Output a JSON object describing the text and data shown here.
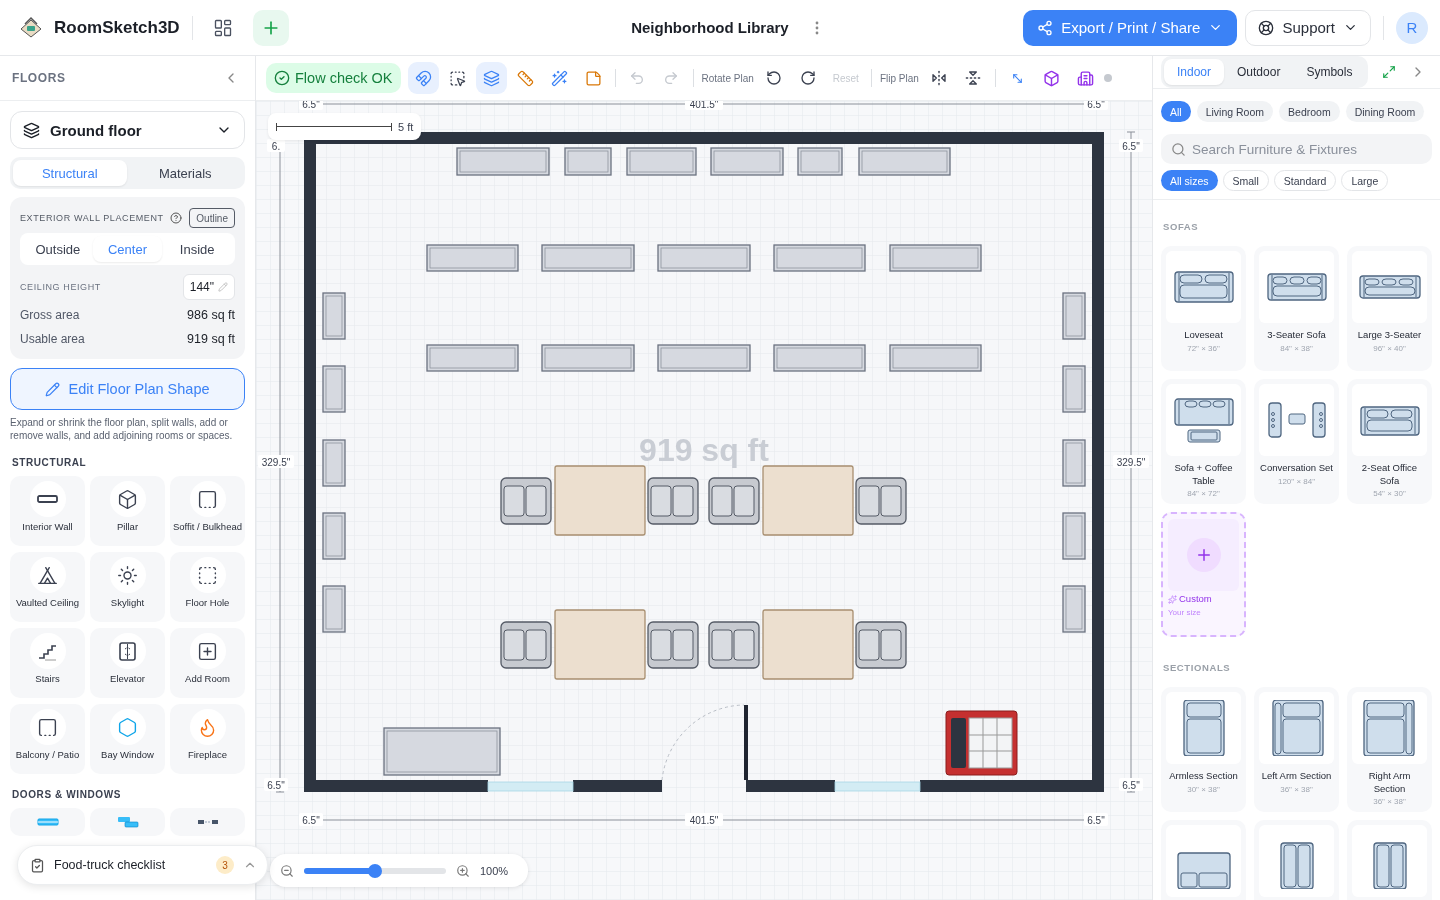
{
  "header": {
    "app_name": "RoomSketch3D",
    "project_title": "Neighborhood Library",
    "export_label": "Export / Print / Share",
    "support_label": "Support",
    "avatar": "R"
  },
  "sidebar": {
    "title": "FLOORS",
    "floor": "Ground floor",
    "tabs": [
      {
        "label": "Structural",
        "selected": true
      },
      {
        "label": "Materials",
        "selected": false
      }
    ],
    "wall_placement": {
      "label": "EXTERIOR WALL PLACEMENT",
      "mode": "Outline",
      "options": [
        {
          "label": "Outside",
          "selected": false
        },
        {
          "label": "Center",
          "selected": true
        },
        {
          "label": "Inside",
          "selected": false
        }
      ]
    },
    "ceiling": {
      "label": "CEILING HEIGHT",
      "value": "144\""
    },
    "areas": [
      {
        "label": "Gross area",
        "value": "986 sq ft"
      },
      {
        "label": "Usable area",
        "value": "919 sq ft"
      }
    ],
    "edit_button": "Edit Floor Plan Shape",
    "help_text": "Expand or shrink the floor plan, split walls, add or remove walls, and add adjoining rooms or spaces.",
    "sections": [
      {
        "title": "STRUCTURAL",
        "items": [
          {
            "kind": "interior-wall",
            "label": "Interior Wall"
          },
          {
            "kind": "pillar",
            "label": "Pillar"
          },
          {
            "kind": "soffit",
            "label": "Soffit / Bulkhead"
          },
          {
            "kind": "vaulted",
            "label": "Vaulted Ceiling"
          },
          {
            "kind": "skylight",
            "label": "Skylight"
          },
          {
            "kind": "floor-hole",
            "label": "Floor Hole"
          },
          {
            "kind": "stairs",
            "label": "Stairs"
          },
          {
            "kind": "elevator",
            "label": "Elevator"
          },
          {
            "kind": "add-room",
            "label": "Add Room"
          },
          {
            "kind": "balcony",
            "label": "Balcony / Patio"
          },
          {
            "kind": "bay-window",
            "label": "Bay Window"
          },
          {
            "kind": "fireplace",
            "label": "Fireplace"
          }
        ]
      },
      {
        "title": "DOORS & WINDOWS",
        "items": [
          {
            "kind": "window"
          },
          {
            "kind": "sliding-window"
          },
          {
            "kind": "opening"
          }
        ]
      }
    ],
    "checklist": {
      "label": "Food-truck checklist",
      "count": "3"
    }
  },
  "toolbar": {
    "status": "Flow check OK",
    "tools": [
      {
        "kind": "magnet",
        "active": true
      },
      {
        "kind": "select",
        "active": false
      },
      {
        "kind": "layers",
        "active": true
      },
      {
        "kind": "ruler",
        "active": false
      },
      {
        "kind": "wand",
        "active": false
      },
      {
        "kind": "note",
        "active": false
      }
    ],
    "history": [
      {
        "kind": "undo",
        "disabled": true
      },
      {
        "kind": "redo",
        "disabled": true
      }
    ],
    "rotate_label": "Rotate Plan",
    "reset": {
      "label": "Reset",
      "disabled": true
    },
    "flip_label": "Flip Plan"
  },
  "plan": {
    "area_label": "919 sq ft",
    "scale_label": "5 ft",
    "top": [
      "6.5\"",
      "401.5\"",
      "6.5\""
    ],
    "bottom": [
      "6.5\"",
      "401.5\"",
      "6.5\""
    ],
    "left": "329.5\"",
    "right": "329.5\"",
    "corners": [
      "6.",
      "6.5\"",
      "6.5\"",
      "6.5\""
    ],
    "zoom": {
      "level": 0.5,
      "reading": "100%"
    }
  },
  "library": {
    "tabs": [
      {
        "label": "Indoor",
        "selected": true
      },
      {
        "label": "Outdoor",
        "selected": false
      },
      {
        "label": "Symbols",
        "selected": false
      }
    ],
    "categories": [
      {
        "label": "All",
        "selected": true
      },
      {
        "label": "Living Room",
        "selected": false
      },
      {
        "label": "Bedroom",
        "selected": false
      },
      {
        "label": "Dining Room",
        "selected": false
      }
    ],
    "search": {
      "placeholder": "Search Furniture & Fixtures"
    },
    "sizes": [
      {
        "label": "All sizes",
        "selected": true
      },
      {
        "label": "Small",
        "selected": false
      },
      {
        "label": "Standard",
        "selected": false
      },
      {
        "label": "Large",
        "selected": false
      }
    ],
    "sections": [
      {
        "title": "SOFAS",
        "items": [
          {
            "kind": "loveseat",
            "name": "Loveseat",
            "size": "72\" × 36\""
          },
          {
            "kind": "three-seater",
            "name": "3-Seater Sofa",
            "size": "84\" × 38\""
          },
          {
            "kind": "large-three",
            "name": "Large 3-Seater",
            "size": "96\" × 40\""
          },
          {
            "kind": "sofa-table",
            "name": "Sofa + Coffee Table",
            "size": "84\" × 72\""
          },
          {
            "kind": "conversation",
            "name": "Conversation Set",
            "size": "120\" × 84\""
          },
          {
            "kind": "office-sofa",
            "name": "2-Seat Office Sofa",
            "size": "54\" × 30\""
          },
          {
            "kind": "custom",
            "name": "Custom",
            "size": "Your size"
          }
        ]
      },
      {
        "title": "SECTIONALS",
        "items": [
          {
            "kind": "armless",
            "name": "Armless Section",
            "size": "30\" × 38\""
          },
          {
            "kind": "left-arm",
            "name": "Left Arm Section",
            "size": "36\" × 38\""
          },
          {
            "kind": "right-arm",
            "name": "Right Arm Section",
            "size": "36\" × 38\""
          },
          {
            "kind": "corner"
          },
          {
            "kind": "chaise-left"
          },
          {
            "kind": "chaise-right"
          }
        ]
      }
    ]
  }
}
